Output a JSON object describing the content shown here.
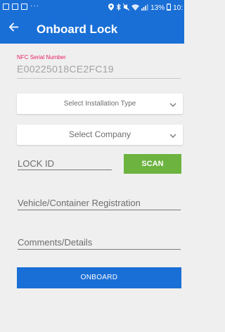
{
  "status_bar": {
    "overflow_dots": "···",
    "battery": "13%",
    "time": "10:"
  },
  "app_bar": {
    "title": "Onboard Lock",
    "back_icon": "arrow-left-icon"
  },
  "nfc": {
    "label": "NFC Serial Number",
    "value": "E00225018CE2FC19"
  },
  "installation_type": {
    "placeholder": "Select Installation Type"
  },
  "company": {
    "placeholder": "Select Company"
  },
  "lock_id": {
    "placeholder": "LOCK ID"
  },
  "scan_button": {
    "label": "SCAN"
  },
  "vehicle": {
    "placeholder": "Vehicle/Container Registration"
  },
  "comments": {
    "placeholder": "Comments/Details"
  },
  "onboard_button": {
    "label": "ONBOARD"
  },
  "colors": {
    "primary": "#1a6fd6",
    "accent_pink": "#e91e63",
    "scan_green": "#6cb33f",
    "background": "#efefef"
  }
}
